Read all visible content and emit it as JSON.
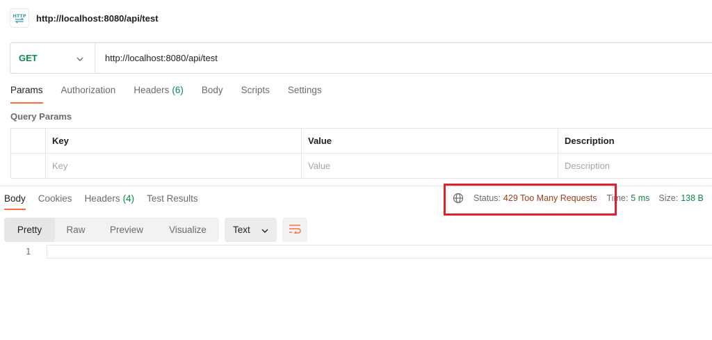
{
  "request": {
    "title": "http://localhost:8080/api/test",
    "icon": "http-file-icon"
  },
  "url_bar": {
    "method": "GET",
    "url": "http://localhost:8080/api/test"
  },
  "request_tabs": {
    "params": "Params",
    "authorization": "Authorization",
    "headers": "Headers",
    "headers_count": "(6)",
    "body": "Body",
    "scripts": "Scripts",
    "settings": "Settings"
  },
  "query_params": {
    "title": "Query Params",
    "columns": [
      "Key",
      "Value",
      "Description"
    ],
    "placeholders": [
      "Key",
      "Value",
      "Description"
    ]
  },
  "response_tabs": {
    "body": "Body",
    "cookies": "Cookies",
    "headers": "Headers",
    "headers_count": "(4)",
    "test_results": "Test Results"
  },
  "response_status": {
    "status_label": "Status:",
    "status_value": "429 Too Many Requests",
    "time_label": "Time:",
    "time_value": "5 ms",
    "size_label": "Size:",
    "size_value": "138 B"
  },
  "body_formats": {
    "pretty": "Pretty",
    "raw": "Raw",
    "preview": "Preview",
    "visualize": "Visualize",
    "type": "Text"
  },
  "editor": {
    "line_number": "1"
  },
  "colors": {
    "method_green": "#0b8a47",
    "active_tab_underline": "#ff6c37",
    "status_error": "#a33d18",
    "highlight_box": "#e0202a"
  }
}
